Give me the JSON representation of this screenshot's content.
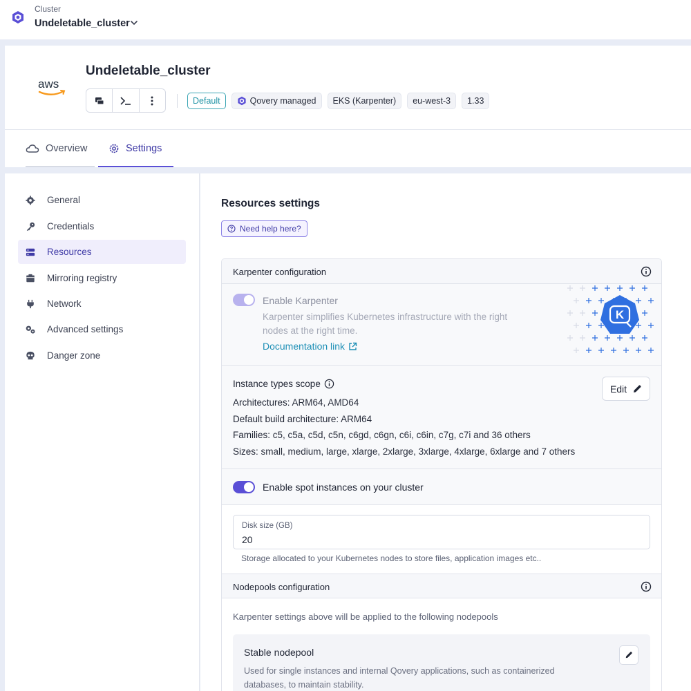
{
  "topbar": {
    "crumb_label": "Cluster",
    "crumb_value": "Undeletable_cluster"
  },
  "header": {
    "provider_logo": "aws",
    "title": "Undeletable_cluster",
    "badges": [
      "Default",
      "Qovery managed",
      "EKS (Karpenter)",
      "eu-west-3",
      "1.33"
    ],
    "actions": [
      "logs-icon",
      "terminal-icon",
      "more-vertical-icon"
    ]
  },
  "tabs": [
    {
      "label": "Overview",
      "icon": "cloud-icon",
      "active": false
    },
    {
      "label": "Settings",
      "icon": "gear-icon",
      "active": true
    }
  ],
  "sidebar": {
    "items": [
      {
        "label": "General",
        "icon": "gear-icon",
        "active": false
      },
      {
        "label": "Credentials",
        "icon": "key-icon",
        "active": false
      },
      {
        "label": "Resources",
        "icon": "server-icon",
        "active": true
      },
      {
        "label": "Mirroring registry",
        "icon": "box-icon",
        "active": false
      },
      {
        "label": "Network",
        "icon": "plug-icon",
        "active": false
      },
      {
        "label": "Advanced settings",
        "icon": "gears-icon",
        "active": false
      },
      {
        "label": "Danger zone",
        "icon": "skull-icon",
        "active": false
      }
    ]
  },
  "main": {
    "title": "Resources settings",
    "help_label": "Need help here?",
    "karpenter": {
      "header": "Karpenter configuration",
      "toggle_label": "Enable Karpenter",
      "toggle_on": true,
      "description": "Karpenter simplifies Kubernetes infrastructure with the right nodes at the right time.",
      "doc_link": "Documentation link",
      "logo_letter": "K"
    },
    "scope": {
      "title": "Instance types scope",
      "edit_label": "Edit",
      "lines": [
        {
          "key": "Architectures:",
          "value": " ARM64, AMD64"
        },
        {
          "key": "Default build architecture:",
          "value": " ARM64"
        },
        {
          "key": "Families:",
          "value": " c5, c5a, c5d, c5n, c6gd, c6gn, c6i, c6in, c7g, c7i and 36 others"
        },
        {
          "key": "Sizes:",
          "value": " small, medium, large, xlarge, 2xlarge, 3xlarge, 4xlarge, 6xlarge and 7 others"
        }
      ]
    },
    "spot": {
      "label": "Enable spot instances on your cluster",
      "toggle_on": true
    },
    "disk": {
      "label": "Disk size (GB)",
      "value": "20",
      "hint": "Storage allocated to your Kubernetes nodes to store files, application images etc.."
    },
    "nodepools": {
      "header": "Nodepools configuration",
      "note": "Karpenter settings above will be applied to the following nodepools",
      "items": [
        {
          "title": "Stable nodepool",
          "description": "Used for single instances and internal Qovery applications, such as containerized databases, to maintain stability."
        }
      ]
    }
  },
  "colors": {
    "accent": "#5a4fd6",
    "accent_light": "#b8b2ee",
    "link": "#1d8fb6",
    "default_badge": "#3ba5b4",
    "karpenter_blue": "#2f6fe0"
  }
}
